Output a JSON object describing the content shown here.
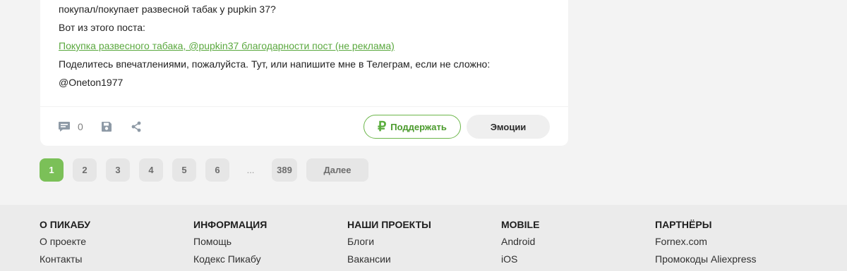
{
  "post": {
    "lines": [
      "покупал/покупает развесной табак у pupkin 37?",
      "Вот из этого поста:"
    ],
    "link_text": "Покупка развесного табака, @pupkin37 благодарности пост (не реклама)",
    "after_lines": [
      "Поделитесь впечатлениями, пожалуйста. Тут, или напишите мне в Телеграм, если не сложно:",
      "@Oneton1977"
    ],
    "comment_count": "0",
    "support_label": "Поддержать",
    "support_symbol": "₽",
    "emotions_label": "Эмоции"
  },
  "pagination": {
    "pages": [
      "1",
      "2",
      "3",
      "4",
      "5",
      "6"
    ],
    "ellipsis": "...",
    "last_page": "389",
    "next_label": "Далее",
    "current": "1"
  },
  "footer": {
    "columns": [
      {
        "title": "О Пикабу",
        "links": [
          "О проекте",
          "Контакты"
        ]
      },
      {
        "title": "Информация",
        "links": [
          "Помощь",
          "Кодекс Пикабу"
        ]
      },
      {
        "title": "Наши проекты",
        "links": [
          "Блоги",
          "Вакансии"
        ]
      },
      {
        "title": "Mobile",
        "links": [
          "Android",
          "iOS"
        ]
      },
      {
        "title": "Партнёры",
        "links": [
          "Fornex.com",
          "Промокоды Aliexpress"
        ]
      }
    ]
  },
  "colors": {
    "accent_green": "#7bc058",
    "link_green": "#5aa83e",
    "background": "#f3f3f3",
    "footer_bg": "#ebebeb"
  },
  "icons": {
    "comment": "comment-icon",
    "save": "save-icon",
    "share": "share-icon",
    "ruble": "ruble-icon"
  }
}
